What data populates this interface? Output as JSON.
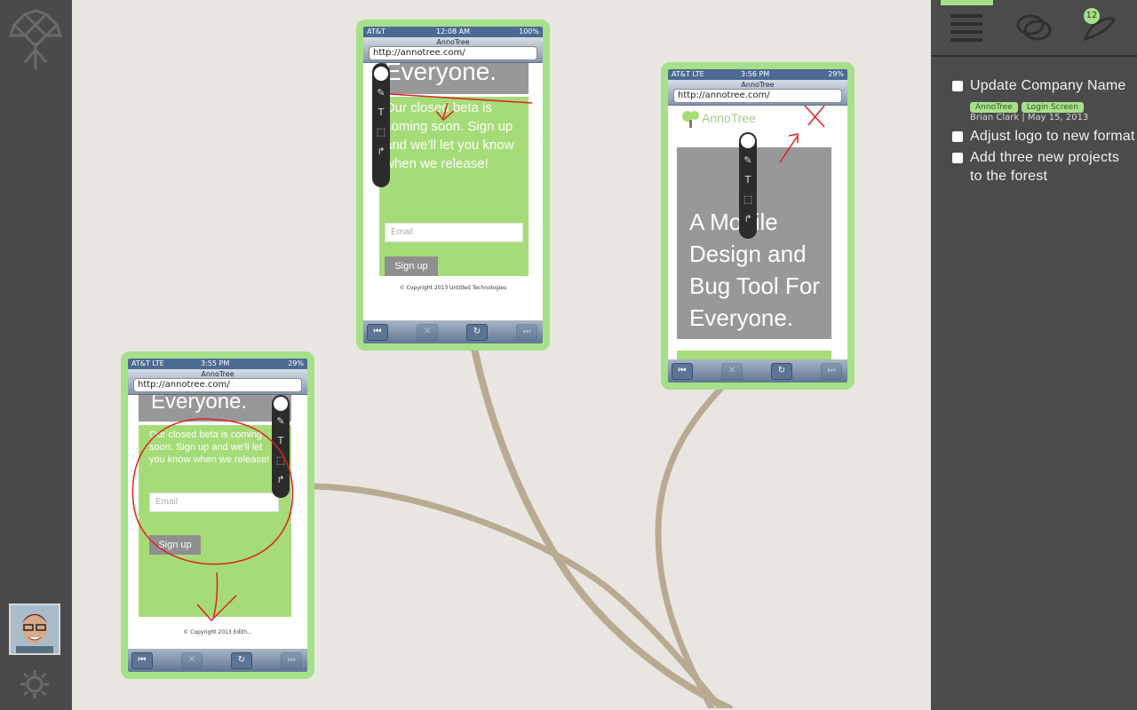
{
  "phones": {
    "top": {
      "carrier": "AT&T",
      "time": "12:08 AM",
      "battery": "100%",
      "app_title": "AnnoTree",
      "url": "http://annotree.com/",
      "headline": "Everyone.",
      "body": "Our closed beta is coming soon. Sign up and we'll let you know when we release!",
      "email_placeholder": "Email",
      "signup_label": "Sign up",
      "copyright": "© Copyright 2013 Untitled Technologies"
    },
    "left": {
      "carrier": "AT&T  LTE",
      "time": "3:55 PM",
      "battery": "29%",
      "app_title": "AnnoTree",
      "url": "http://annotree.com/",
      "headline": "Everyone.",
      "body": "Our closed beta is coming soon. Sign up and we'll let you know when we release!",
      "email_placeholder": "Email",
      "signup_label": "Sign up",
      "copyright": "© Copyright 2013 Edith..."
    },
    "right": {
      "carrier": "AT&T  LTE",
      "time": "3:56 PM",
      "battery": "29%",
      "app_title": "AnnoTree",
      "url": "http://annotree.com/",
      "logo_text": "AnnoTree",
      "headline": "A Mobile Design and Bug Tool For Everyone."
    }
  },
  "right_panel": {
    "badge_count": "12",
    "tasks": [
      {
        "label": "Update Company Name",
        "tags": [
          "AnnoTree",
          "Login Screen"
        ],
        "meta": "Brian Clark | May 15, 2013"
      },
      {
        "label": "Adjust logo to new format"
      },
      {
        "label": "Add three new projects",
        "label2": "to the forest"
      }
    ]
  },
  "colors": {
    "accent_green": "#a7e08a",
    "sidebar": "#4a4a4a",
    "canvas": "#e9e6e2",
    "annotation_red": "#e02020"
  }
}
